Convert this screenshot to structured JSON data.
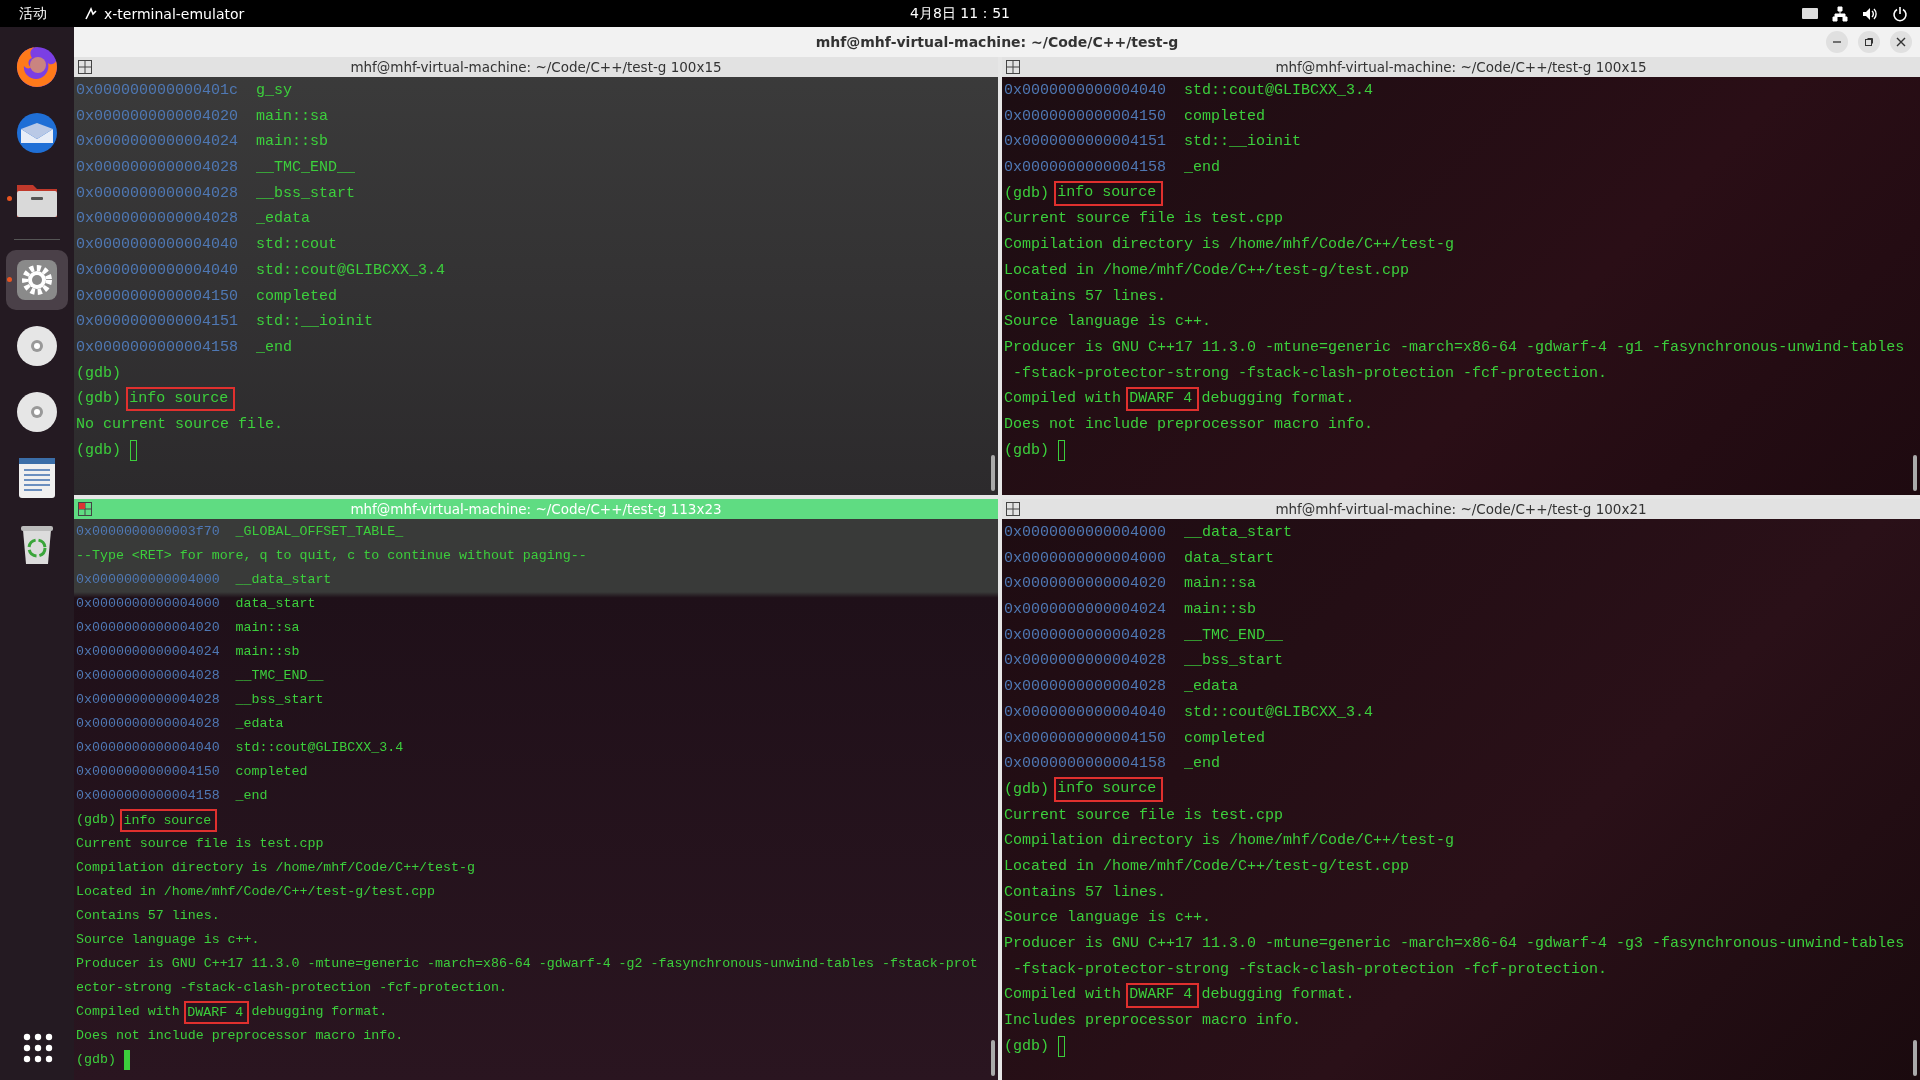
{
  "top_bar": {
    "activities": "活动",
    "app_name": "x-terminal-emulator",
    "clock": "4月8日  11：51"
  },
  "dock": {
    "items": [
      {
        "kind": "firefox",
        "running": false,
        "selected": false
      },
      {
        "kind": "mail",
        "running": false,
        "selected": false
      },
      {
        "kind": "files",
        "running": true,
        "selected": false
      },
      {
        "kind": "settings",
        "running": true,
        "selected": true
      },
      {
        "kind": "disc",
        "running": false,
        "selected": false
      },
      {
        "kind": "disc",
        "running": false,
        "selected": false
      },
      {
        "kind": "document",
        "running": false,
        "selected": false
      },
      {
        "kind": "trash",
        "running": false,
        "selected": false
      }
    ]
  },
  "window": {
    "title": "mhf@mhf-virtual-machine: ~/Code/C++/test-g",
    "panes": [
      {
        "title": "mhf@mhf-virtual-machine: ~/Code/C++/test-g 100x15",
        "focused": false,
        "lines": [
          {
            "parts": [
              {
                "kind": "address",
                "text": "0x000000000000401c"
              },
              {
                "kind": "symbol",
                "text": "g_sy"
              }
            ]
          },
          {
            "parts": [
              {
                "kind": "address",
                "text": "0x0000000000004020"
              },
              {
                "kind": "symbol",
                "text": "main::sa"
              }
            ]
          },
          {
            "parts": [
              {
                "kind": "address",
                "text": "0x0000000000004024"
              },
              {
                "kind": "symbol",
                "text": "main::sb"
              }
            ]
          },
          {
            "parts": [
              {
                "kind": "address",
                "text": "0x0000000000004028"
              },
              {
                "kind": "symbol",
                "text": "__TMC_END__"
              }
            ]
          },
          {
            "parts": [
              {
                "kind": "address",
                "text": "0x0000000000004028"
              },
              {
                "kind": "symbol",
                "text": "__bss_start"
              }
            ]
          },
          {
            "parts": [
              {
                "kind": "address",
                "text": "0x0000000000004028"
              },
              {
                "kind": "symbol",
                "text": "_edata"
              }
            ]
          },
          {
            "parts": [
              {
                "kind": "address",
                "text": "0x0000000000004040"
              },
              {
                "kind": "symbol",
                "text": "std::cout"
              }
            ]
          },
          {
            "parts": [
              {
                "kind": "address",
                "text": "0x0000000000004040"
              },
              {
                "kind": "symbol",
                "text": "std::cout@GLIBCXX_3.4"
              }
            ]
          },
          {
            "parts": [
              {
                "kind": "address",
                "text": "0x0000000000004150"
              },
              {
                "kind": "symbol",
                "text": "completed"
              }
            ]
          },
          {
            "parts": [
              {
                "kind": "address",
                "text": "0x0000000000004151"
              },
              {
                "kind": "symbol",
                "text": "std::__ioinit"
              }
            ]
          },
          {
            "parts": [
              {
                "kind": "address",
                "text": "0x0000000000004158"
              },
              {
                "kind": "symbol",
                "text": "_end"
              }
            ]
          },
          {
            "parts": [
              {
                "kind": "text",
                "text": "(gdb)"
              }
            ]
          },
          {
            "parts": [
              {
                "kind": "text",
                "text": "(gdb)"
              },
              {
                "kind": "marked",
                "text": "info source"
              }
            ]
          },
          {
            "parts": [
              {
                "kind": "text",
                "text": "No current source file."
              }
            ]
          },
          {
            "parts": [
              {
                "kind": "text",
                "text": "(gdb)"
              }
            ],
            "cursor": {
              "filled": false
            }
          }
        ]
      },
      {
        "title": "mhf@mhf-virtual-machine: ~/Code/C++/test-g 100x15",
        "focused": false,
        "lines": [
          {
            "parts": [
              {
                "kind": "address",
                "text": "0x0000000000004040"
              },
              {
                "kind": "symbol",
                "text": "std::cout@GLIBCXX_3.4"
              }
            ]
          },
          {
            "parts": [
              {
                "kind": "address",
                "text": "0x0000000000004150"
              },
              {
                "kind": "symbol",
                "text": "completed"
              }
            ]
          },
          {
            "parts": [
              {
                "kind": "address",
                "text": "0x0000000000004151"
              },
              {
                "kind": "symbol",
                "text": "std::__ioinit"
              }
            ]
          },
          {
            "parts": [
              {
                "kind": "address",
                "text": "0x0000000000004158"
              },
              {
                "kind": "symbol",
                "text": "_end"
              }
            ]
          },
          {
            "parts": [
              {
                "kind": "text",
                "text": "(gdb)"
              },
              {
                "kind": "marked",
                "text": "info source"
              }
            ]
          },
          {
            "parts": [
              {
                "kind": "text",
                "text": "Current source file is test.cpp"
              }
            ]
          },
          {
            "parts": [
              {
                "kind": "text",
                "text": "Compilation directory is /home/mhf/Code/C++/test-g"
              }
            ]
          },
          {
            "parts": [
              {
                "kind": "text",
                "text": "Located in /home/mhf/Code/C++/test-g/test.cpp"
              }
            ]
          },
          {
            "parts": [
              {
                "kind": "text",
                "text": "Contains 57 lines."
              }
            ]
          },
          {
            "parts": [
              {
                "kind": "text",
                "text": "Source language is c++."
              }
            ]
          },
          {
            "parts": [
              {
                "kind": "text",
                "text": "Producer is GNU C++17 11.3.0 -mtune=generic -march=x86-64 -gdwarf-4 -g1 -fasynchronous-unwind-tables"
              }
            ]
          },
          {
            "parts": [
              {
                "kind": "text",
                "text": " -fstack-protector-strong -fstack-clash-protection -fcf-protection."
              }
            ]
          },
          {
            "parts": [
              {
                "kind": "text",
                "text": "Compiled with"
              },
              {
                "kind": "marked",
                "text": "DWARF 4"
              },
              {
                "kind": "text",
                "text": "debugging format."
              }
            ]
          },
          {
            "parts": [
              {
                "kind": "text",
                "text": "Does not include preprocessor macro info."
              }
            ]
          },
          {
            "parts": [
              {
                "kind": "text",
                "text": "(gdb)"
              }
            ],
            "cursor": {
              "filled": false
            }
          }
        ]
      },
      {
        "title": "mhf@mhf-virtual-machine: ~/Code/C++/test-g 113x23",
        "focused": true,
        "lines": [
          {
            "parts": [
              {
                "kind": "address",
                "text": "0x0000000000003f70"
              },
              {
                "kind": "symbol",
                "text": "_GLOBAL_OFFSET_TABLE_"
              }
            ]
          },
          {
            "parts": [
              {
                "kind": "text",
                "text": "--Type <RET> for more, q to quit, c to continue without paging--"
              }
            ]
          },
          {
            "parts": [
              {
                "kind": "address",
                "text": "0x0000000000004000"
              },
              {
                "kind": "symbol",
                "text": "__data_start"
              }
            ]
          },
          {
            "parts": [
              {
                "kind": "address",
                "text": "0x0000000000004000"
              },
              {
                "kind": "symbol",
                "text": "data_start"
              }
            ]
          },
          {
            "parts": [
              {
                "kind": "address",
                "text": "0x0000000000004020"
              },
              {
                "kind": "symbol",
                "text": "main::sa"
              }
            ]
          },
          {
            "parts": [
              {
                "kind": "address",
                "text": "0x0000000000004024"
              },
              {
                "kind": "symbol",
                "text": "main::sb"
              }
            ]
          },
          {
            "parts": [
              {
                "kind": "address",
                "text": "0x0000000000004028"
              },
              {
                "kind": "symbol",
                "text": "__TMC_END__"
              }
            ]
          },
          {
            "parts": [
              {
                "kind": "address",
                "text": "0x0000000000004028"
              },
              {
                "kind": "symbol",
                "text": "__bss_start"
              }
            ]
          },
          {
            "parts": [
              {
                "kind": "address",
                "text": "0x0000000000004028"
              },
              {
                "kind": "symbol",
                "text": "_edata"
              }
            ]
          },
          {
            "parts": [
              {
                "kind": "address",
                "text": "0x0000000000004040"
              },
              {
                "kind": "symbol",
                "text": "std::cout@GLIBCXX_3.4"
              }
            ]
          },
          {
            "parts": [
              {
                "kind": "address",
                "text": "0x0000000000004150"
              },
              {
                "kind": "symbol",
                "text": "completed"
              }
            ]
          },
          {
            "parts": [
              {
                "kind": "address",
                "text": "0x0000000000004158"
              },
              {
                "kind": "symbol",
                "text": "_end"
              }
            ]
          },
          {
            "parts": [
              {
                "kind": "text",
                "text": "(gdb)"
              },
              {
                "kind": "marked",
                "text": "info source"
              }
            ]
          },
          {
            "parts": [
              {
                "kind": "text",
                "text": "Current source file is test.cpp"
              }
            ]
          },
          {
            "parts": [
              {
                "kind": "text",
                "text": "Compilation directory is /home/mhf/Code/C++/test-g"
              }
            ]
          },
          {
            "parts": [
              {
                "kind": "text",
                "text": "Located in /home/mhf/Code/C++/test-g/test.cpp"
              }
            ]
          },
          {
            "parts": [
              {
                "kind": "text",
                "text": "Contains 57 lines."
              }
            ]
          },
          {
            "parts": [
              {
                "kind": "text",
                "text": "Source language is c++."
              }
            ]
          },
          {
            "parts": [
              {
                "kind": "text",
                "text": "Producer is GNU C++17 11.3.0 -mtune=generic -march=x86-64 -gdwarf-4 -g2 -fasynchronous-unwind-tables -fstack-prot"
              }
            ]
          },
          {
            "parts": [
              {
                "kind": "text",
                "text": "ector-strong -fstack-clash-protection -fcf-protection."
              }
            ]
          },
          {
            "parts": [
              {
                "kind": "text",
                "text": "Compiled with"
              },
              {
                "kind": "marked",
                "text": "DWARF 4"
              },
              {
                "kind": "text",
                "text": "debugging format."
              }
            ]
          },
          {
            "parts": [
              {
                "kind": "text",
                "text": "Does not include preprocessor macro info."
              }
            ]
          },
          {
            "parts": [
              {
                "kind": "text",
                "text": "(gdb)"
              }
            ],
            "cursor": {
              "filled": true
            }
          }
        ]
      },
      {
        "title": "mhf@mhf-virtual-machine: ~/Code/C++/test-g 100x21",
        "focused": false,
        "lines": [
          {
            "parts": [
              {
                "kind": "address",
                "text": "0x0000000000004000"
              },
              {
                "kind": "symbol",
                "text": "__data_start"
              }
            ]
          },
          {
            "parts": [
              {
                "kind": "address",
                "text": "0x0000000000004000"
              },
              {
                "kind": "symbol",
                "text": "data_start"
              }
            ]
          },
          {
            "parts": [
              {
                "kind": "address",
                "text": "0x0000000000004020"
              },
              {
                "kind": "symbol",
                "text": "main::sa"
              }
            ]
          },
          {
            "parts": [
              {
                "kind": "address",
                "text": "0x0000000000004024"
              },
              {
                "kind": "symbol",
                "text": "main::sb"
              }
            ]
          },
          {
            "parts": [
              {
                "kind": "address",
                "text": "0x0000000000004028"
              },
              {
                "kind": "symbol",
                "text": "__TMC_END__"
              }
            ]
          },
          {
            "parts": [
              {
                "kind": "address",
                "text": "0x0000000000004028"
              },
              {
                "kind": "symbol",
                "text": "__bss_start"
              }
            ]
          },
          {
            "parts": [
              {
                "kind": "address",
                "text": "0x0000000000004028"
              },
              {
                "kind": "symbol",
                "text": "_edata"
              }
            ]
          },
          {
            "parts": [
              {
                "kind": "address",
                "text": "0x0000000000004040"
              },
              {
                "kind": "symbol",
                "text": "std::cout@GLIBCXX_3.4"
              }
            ]
          },
          {
            "parts": [
              {
                "kind": "address",
                "text": "0x0000000000004150"
              },
              {
                "kind": "symbol",
                "text": "completed"
              }
            ]
          },
          {
            "parts": [
              {
                "kind": "address",
                "text": "0x0000000000004158"
              },
              {
                "kind": "symbol",
                "text": "_end"
              }
            ]
          },
          {
            "parts": [
              {
                "kind": "text",
                "text": "(gdb)"
              },
              {
                "kind": "marked",
                "text": "info source"
              }
            ]
          },
          {
            "parts": [
              {
                "kind": "text",
                "text": "Current source file is test.cpp"
              }
            ]
          },
          {
            "parts": [
              {
                "kind": "text",
                "text": "Compilation directory is /home/mhf/Code/C++/test-g"
              }
            ]
          },
          {
            "parts": [
              {
                "kind": "text",
                "text": "Located in /home/mhf/Code/C++/test-g/test.cpp"
              }
            ]
          },
          {
            "parts": [
              {
                "kind": "text",
                "text": "Contains 57 lines."
              }
            ]
          },
          {
            "parts": [
              {
                "kind": "text",
                "text": "Source language is c++."
              }
            ]
          },
          {
            "parts": [
              {
                "kind": "text",
                "text": "Producer is GNU C++17 11.3.0 -mtune=generic -march=x86-64 -gdwarf-4 -g3 -fasynchronous-unwind-tables"
              }
            ]
          },
          {
            "parts": [
              {
                "kind": "text",
                "text": " -fstack-protector-strong -fstack-clash-protection -fcf-protection."
              }
            ]
          },
          {
            "parts": [
              {
                "kind": "text",
                "text": "Compiled with"
              },
              {
                "kind": "marked",
                "text": "DWARF 4"
              },
              {
                "kind": "text",
                "text": "debugging format."
              }
            ]
          },
          {
            "parts": [
              {
                "kind": "text",
                "text": "Includes preprocessor macro info."
              }
            ]
          },
          {
            "parts": [
              {
                "kind": "text",
                "text": "(gdb)"
              }
            ],
            "cursor": {
              "filled": false
            }
          }
        ]
      }
    ]
  }
}
